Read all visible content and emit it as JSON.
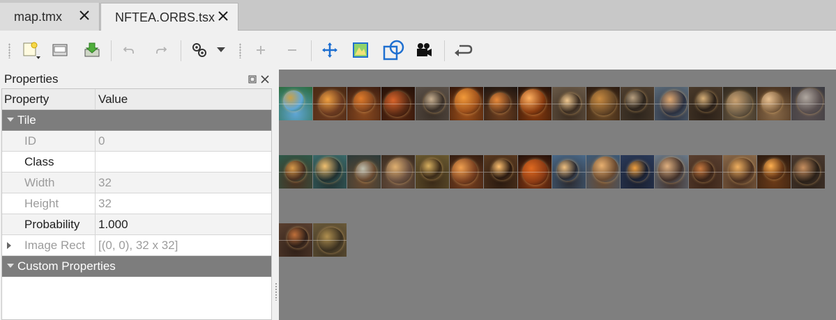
{
  "tabs": [
    {
      "label": "map.tmx",
      "active": false
    },
    {
      "label": "NFTEA.ORBS.tsx",
      "active": true
    }
  ],
  "toolbar": {
    "icons": [
      "new-tileset-icon",
      "open-icon",
      "save-icon",
      "undo-icon",
      "redo-icon",
      "tileset-properties-icon",
      "add-tiles-icon",
      "remove-tiles-icon",
      "dynamic-wrapping-icon",
      "edit-terrain-icon",
      "edit-collision-icon",
      "edit-animation-icon",
      "back-icon"
    ]
  },
  "properties_panel": {
    "title": "Properties",
    "headers": {
      "property": "Property",
      "value": "Value"
    },
    "groups": {
      "tile": "Tile",
      "custom": "Custom Properties"
    },
    "rows": [
      {
        "name": "ID",
        "value": "0",
        "readonly": true
      },
      {
        "name": "Class",
        "value": "",
        "readonly": false
      },
      {
        "name": "Width",
        "value": "32",
        "readonly": true
      },
      {
        "name": "Height",
        "value": "32",
        "readonly": true
      },
      {
        "name": "Probability",
        "value": "1.000",
        "readonly": false
      },
      {
        "name": "Image Rect",
        "value": "[(0, 0), 32 x 32]",
        "readonly": true
      }
    ]
  },
  "tileset": {
    "tile_count": 34,
    "colors": {
      "background": "#7f7f7f",
      "selection": "#3c7fd6"
    }
  }
}
